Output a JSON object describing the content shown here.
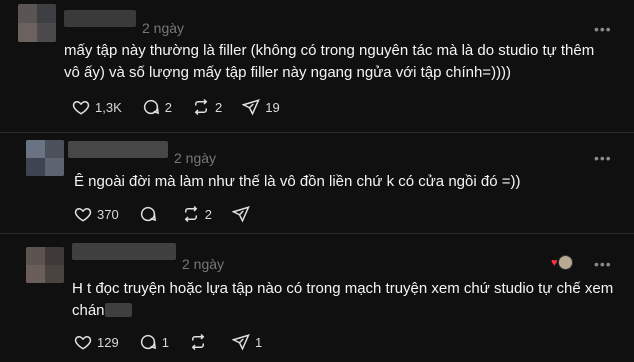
{
  "comments": [
    {
      "time": "2 ngày",
      "text_line1": "mấy tập này thường là filler (không có trong nguyên tác mà là do studio tự thêm",
      "text_line2": "vô ấy) và số lượng mấy tập filler này ngang ngửa với tập chính=))))",
      "likes": "1,3K",
      "replies": "2",
      "reposts": "2",
      "shares": "19"
    },
    {
      "time": "2 ngày",
      "text_line1": "Ê ngoài đời mà làm như thế là vô đồn liền chứ k có cửa ngồi đó =))",
      "likes": "370",
      "replies": "",
      "reposts": "2",
      "shares": ""
    },
    {
      "time": "2 ngày",
      "text_line1": "H t đọc truyện hoặc lựa tập nào có trong mạch truyện xem chứ studio tự chế xem",
      "text_line2": "chán",
      "likes": "129",
      "replies": "1",
      "reposts": "",
      "shares": "1"
    }
  ],
  "icons": {
    "like": "heart-outline-icon",
    "reply": "speech-bubble-icon",
    "repost": "repost-arrows-icon",
    "share": "send-paper-plane-icon",
    "more": "more-horizontal-icon",
    "liked_by_author": "heart-badge-icon"
  },
  "colors": {
    "background": "#101010",
    "text": "#f3f5f7",
    "muted": "#777777",
    "divider": "#2d2d2d",
    "heart_red": "#ff3040"
  }
}
